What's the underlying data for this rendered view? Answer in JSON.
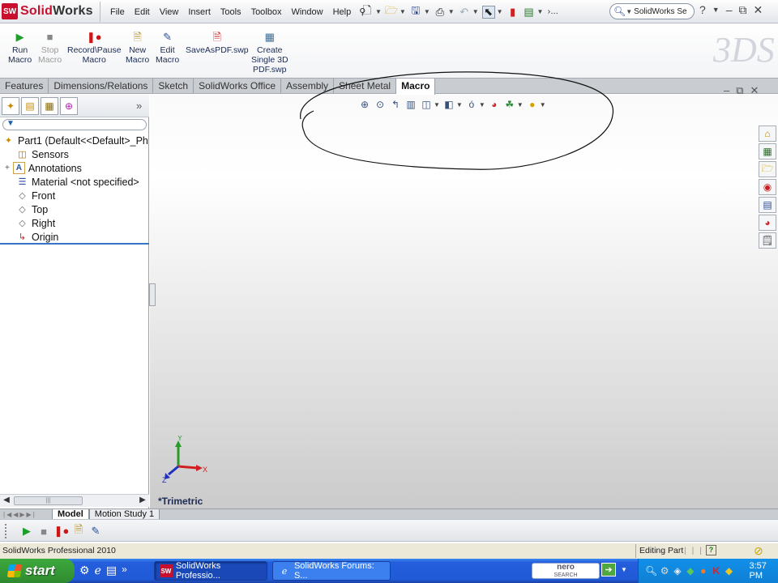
{
  "app": {
    "logo_text": "SolidWorks",
    "logo_mark": "SW"
  },
  "menus": [
    "File",
    "Edit",
    "View",
    "Insert",
    "Tools",
    "Toolbox",
    "Window",
    "Help"
  ],
  "search": {
    "placeholder": "SolidWorks Se"
  },
  "command_manager": {
    "buttons": [
      {
        "label_line1": "Run",
        "label_line2": "Macro",
        "icon": "play-icon"
      },
      {
        "label_line1": "Stop",
        "label_line2": "Macro",
        "icon": "stop-icon"
      },
      {
        "label_line1": "Record\\Pause",
        "label_line2": "Macro",
        "icon": "record-pause-icon"
      },
      {
        "label_line1": "New",
        "label_line2": "Macro",
        "icon": "new-macro-icon"
      },
      {
        "label_line1": "Edit",
        "label_line2": "Macro",
        "icon": "edit-macro-icon"
      },
      {
        "label_line1": "SaveAsPDF.swp",
        "label_line2": "",
        "icon": "pdf-icon"
      },
      {
        "label_line1": "Create",
        "label_line2": "Single 3D",
        "label_line3": "PDF.swp",
        "icon": "pdf-3d-icon"
      }
    ],
    "watermark": "3DS"
  },
  "tabs": [
    "Features",
    "Dimensions/Relations",
    "Sketch",
    "SolidWorks Office",
    "Assembly",
    "Sheet Metal",
    "Macro"
  ],
  "active_tab": "Macro",
  "tree": {
    "root": "Part1  (Default<<Default>_Ph",
    "items": [
      "Sensors",
      "Annotations",
      "Material <not specified>",
      "Front",
      "Top",
      "Right",
      "Origin"
    ]
  },
  "filter_icon": "funnel-icon",
  "view": {
    "name": "*Trimetric",
    "axes": {
      "x": "X",
      "y": "Y",
      "z": "Z"
    }
  },
  "bottom_tabs": [
    "Model",
    "Motion Study 1"
  ],
  "active_bottom_tab": "Model",
  "status": {
    "left": "SolidWorks Professional 2010",
    "mode": "Editing Part",
    "help": "?",
    "bars": "| | |"
  },
  "taskbar": {
    "start": "start",
    "chevron": "»",
    "tasks": [
      {
        "label": "SolidWorks Professio...",
        "active": true
      },
      {
        "label": "SolidWorks Forums: S...",
        "active": false
      }
    ],
    "nero_line1": "nero",
    "nero_line2": "SEARCH",
    "clock": "3:57 PM"
  },
  "colors": {
    "brand": "#c8102e",
    "tab_active_text": "#111111",
    "taskbar": "#245edc",
    "start": "#3da93d"
  }
}
